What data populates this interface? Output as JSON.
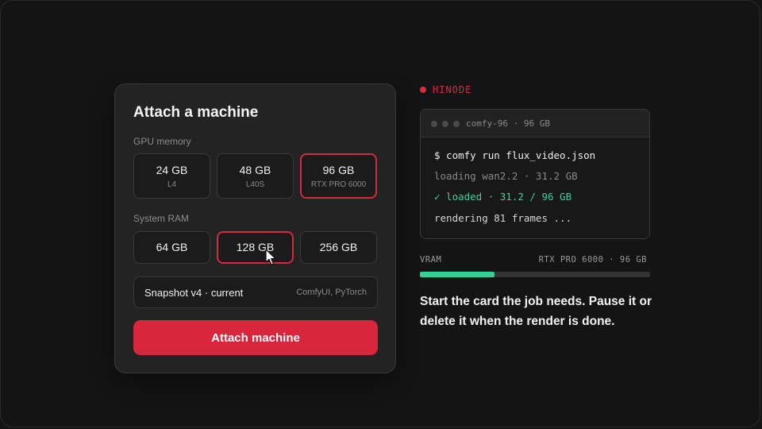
{
  "card": {
    "title": "Attach a machine",
    "gpu_label": "GPU memory",
    "gpu_options": [
      {
        "main": "24 GB",
        "sub": "L4",
        "selected": false
      },
      {
        "main": "48 GB",
        "sub": "L40S",
        "selected": false
      },
      {
        "main": "96 GB",
        "sub": "RTX PRO 6000",
        "selected": true
      }
    ],
    "ram_label": "System RAM",
    "ram_options": [
      {
        "main": "64 GB",
        "selected": false
      },
      {
        "main": "128 GB",
        "selected": true
      },
      {
        "main": "256 GB",
        "selected": false
      }
    ],
    "snapshot": {
      "title": "Snapshot v4 · current",
      "meta": "ComfyUI, PyTorch"
    },
    "attach_label": "Attach machine"
  },
  "brand": {
    "name": "HINODE",
    "color": "#e0283f"
  },
  "terminal": {
    "title": "comfy-96 · 96 GB",
    "lines": [
      "$ comfy run flux_video.json",
      "loading wan2.2 · 31.2 GB",
      "✓ loaded · 31.2 / 96 GB",
      "rendering 81 frames ..."
    ]
  },
  "vram": {
    "label": "VRAM",
    "meta": "RTX PRO 6000 · 96 GB",
    "used_fraction": 0.325,
    "fill_color": "#35cf97"
  },
  "tagline": "Start the card the job needs. Pause it or delete it when the render is done.",
  "colors": {
    "accent": "#d8263c",
    "success": "#38d39a",
    "background": "#141414"
  }
}
